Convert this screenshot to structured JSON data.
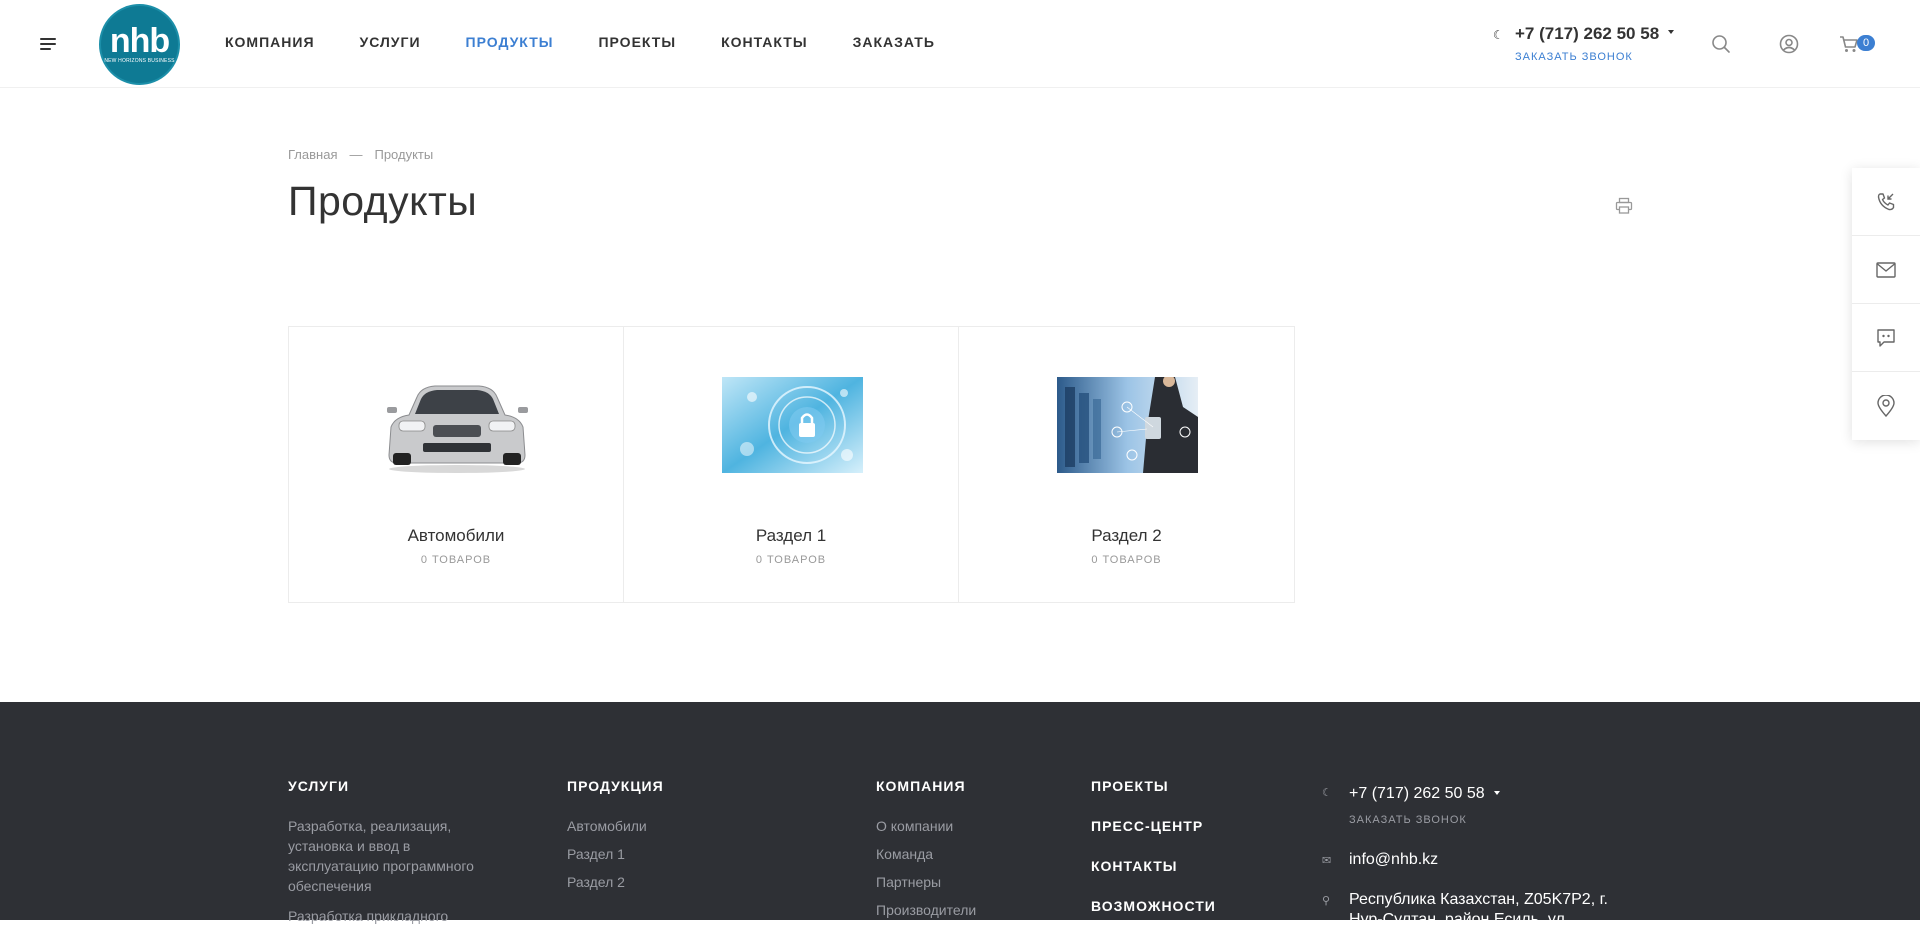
{
  "header": {
    "logo_text": "nhb",
    "logo_sub": "NEW HORIZONS BUSINESS",
    "nav": [
      {
        "label": "КОМПАНИЯ"
      },
      {
        "label": "УСЛУГИ"
      },
      {
        "label": "ПРОДУКТЫ"
      },
      {
        "label": "ПРОЕКТЫ"
      },
      {
        "label": "КОНТАКТЫ"
      },
      {
        "label": "ЗАКАЗАТЬ"
      }
    ],
    "active_nav": "ПРОДУКТЫ",
    "phone": "+7 (717) 262 50 58",
    "callback": "ЗАКАЗАТЬ ЗВОНОК",
    "cart_count": "0",
    "accent_color": "#3c7fd2"
  },
  "breadcrumb": {
    "home": "Главная",
    "separator": "—",
    "current": "Продукты"
  },
  "page_title": "Продукты",
  "sections": [
    {
      "name": "Автомобили",
      "count": "0 ТОВАРОВ",
      "image": "car-image"
    },
    {
      "name": "Раздел 1",
      "count": "0 ТОВАРОВ",
      "image": "security-lock-image"
    },
    {
      "name": "Раздел 2",
      "count": "0 ТОВАРОВ",
      "image": "server-tech-image"
    }
  ],
  "right_panel": [
    "callback-icon",
    "mail-icon",
    "chat-icon",
    "location-icon"
  ],
  "footer": {
    "services": {
      "heading": "УСЛУГИ",
      "item1": "Разработка, реализация, установка и ввод в эксплуатацию программного обеспечения",
      "item2": "Разработка прикладного"
    },
    "products": {
      "heading": "ПРОДУКЦИЯ",
      "links": [
        "Автомобили",
        "Раздел 1",
        "Раздел 2"
      ]
    },
    "company": {
      "heading": "КОМПАНИЯ",
      "links": [
        "О компании",
        "Команда",
        "Партнеры",
        "Производители"
      ]
    },
    "misc": {
      "headings": [
        "ПРОЕКТЫ",
        "ПРЕСС-ЦЕНТР",
        "КОНТАКТЫ",
        "ВОЗМОЖНОСТИ"
      ]
    },
    "contacts": {
      "phone": "+7 (717) 262 50 58",
      "callback": "ЗАКАЗАТЬ ЗВОНОК",
      "email": "info@nhb.kz",
      "address_line1": "Республика Казахстан, Z05K7P2, г.",
      "address_line2": "Нур-Султан, район Есиль, ул."
    },
    "bg_color": "#2e3035"
  }
}
